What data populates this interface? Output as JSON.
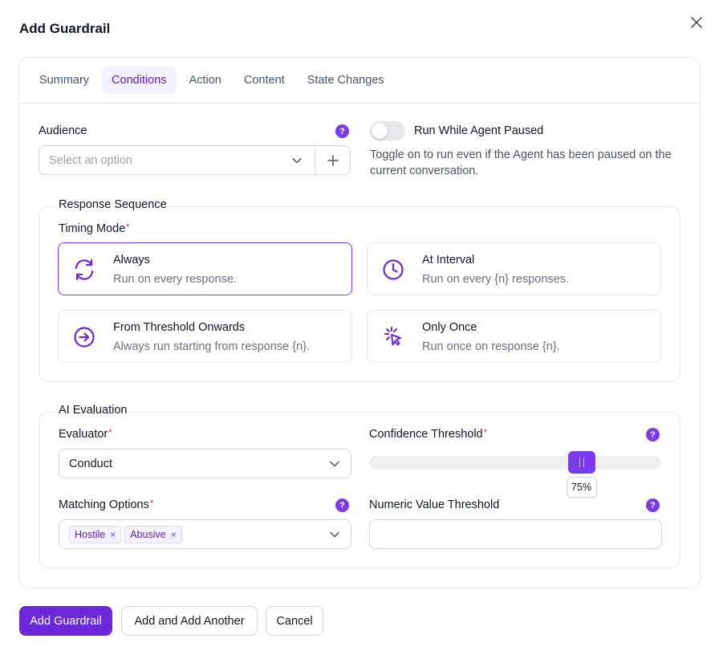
{
  "modal": {
    "title": "Add Guardrail"
  },
  "tabs": [
    {
      "label": "Summary"
    },
    {
      "label": "Conditions"
    },
    {
      "label": "Action"
    },
    {
      "label": "Content"
    },
    {
      "label": "State Changes"
    }
  ],
  "active_tab": "Conditions",
  "audience": {
    "label": "Audience",
    "placeholder": "Select an option",
    "help": "?"
  },
  "run_while_paused": {
    "label": "Run While Agent Paused",
    "description_line1": "Toggle on to run even if the Agent has been paused on the",
    "description_line2": "current conversation.",
    "enabled": false
  },
  "response_sequence": {
    "legend": "Response Sequence",
    "timing_mode_label": "Timing Mode",
    "required_mark": "*",
    "options": [
      {
        "title": "Always",
        "description": "Run on every response.",
        "icon": "refresh-icon",
        "selected": true
      },
      {
        "title": "At Interval",
        "description": "Run on every {n} responses.",
        "icon": "clock-icon",
        "selected": false
      },
      {
        "title": "From Threshold Onwards",
        "description": "Always run starting from response {n}.",
        "icon": "arrow-right-circle-icon",
        "selected": false
      },
      {
        "title": "Only Once",
        "description": "Run once on response {n}.",
        "icon": "click-pointer-icon",
        "selected": false
      }
    ]
  },
  "ai_evaluation": {
    "legend": "AI Evaluation",
    "evaluator": {
      "label": "Evaluator",
      "value": "Conduct"
    },
    "confidence_threshold": {
      "label": "Confidence Threshold",
      "value": 0.75,
      "display": "75%"
    },
    "matching_options": {
      "label": "Matching Options",
      "chips": [
        "Hostile",
        "Abusive"
      ],
      "remove_glyph": "×"
    },
    "numeric_value_threshold": {
      "label": "Numeric Value Threshold",
      "value": ""
    },
    "required_mark": "*",
    "help": "?"
  },
  "footer": {
    "add_label": "Add Guardrail",
    "add_another_label": "Add and Add Another",
    "cancel_label": "Cancel"
  },
  "colors": {
    "accent": "#6d28d9",
    "accent_light": "#7c3aed",
    "border": "#e5e7eb",
    "required": "#dc2626"
  }
}
